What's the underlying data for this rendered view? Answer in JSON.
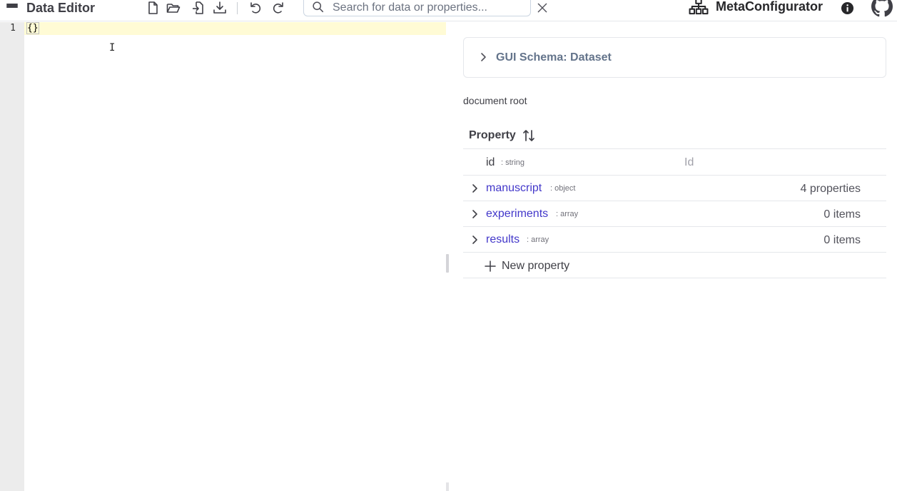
{
  "toolbar": {
    "title": "Data Editor",
    "search_placeholder": "Search for data or properties...",
    "brand_name": "MetaConfigurator",
    "icons": [
      "menu-icon",
      "new-file-icon",
      "open-folder-icon",
      "import-icon",
      "download-icon",
      "undo-icon",
      "redo-icon",
      "search-icon",
      "close-icon",
      "sitemap-icon",
      "info-icon",
      "github-icon"
    ]
  },
  "editor": {
    "line_numbers": [
      "1"
    ],
    "content": "{}"
  },
  "gui": {
    "schema_panel_title": "GUI Schema: Dataset",
    "breadcrumb": "document root",
    "table_header": "Property",
    "rows": [
      {
        "name": "id",
        "type": ": string",
        "placeholder": "Id",
        "expandable": false
      },
      {
        "name": "manuscript",
        "type": ": object",
        "value": "4 properties",
        "expandable": true
      },
      {
        "name": "experiments",
        "type": ": array",
        "value": "0 items",
        "expandable": true
      },
      {
        "name": "results",
        "type": ": array",
        "value": "0 items",
        "expandable": true
      }
    ],
    "new_property_label": "New property"
  },
  "colors": {
    "link": "#4338ca",
    "active_line": "#fffbd5",
    "gutter": "#ececec"
  }
}
